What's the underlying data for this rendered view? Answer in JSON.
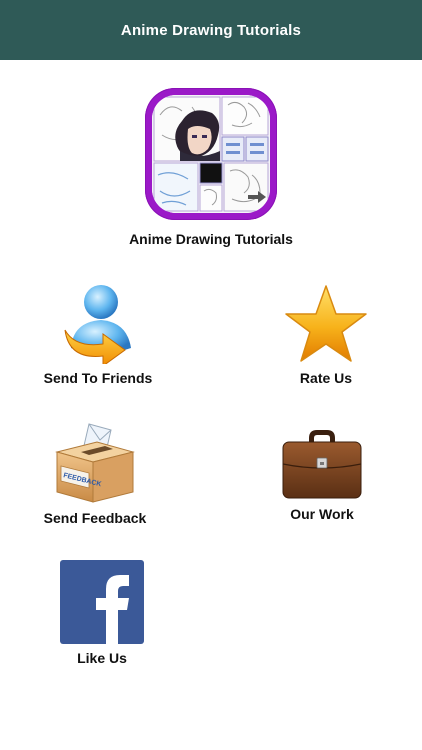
{
  "header": {
    "title": "Anime Drawing Tutorials"
  },
  "app": {
    "name": "Anime Drawing Tutorials"
  },
  "menu": {
    "send_to_friends": "Send To Friends",
    "rate_us": "Rate Us",
    "send_feedback": "Send Feedback",
    "our_work": "Our Work",
    "like_us": "Like Us",
    "feedback_box_text": "FEEDBACK"
  },
  "icons": {
    "app": "anime-drawing-app-icon",
    "send_to_friends": "user-share-icon",
    "rate_us": "star-icon",
    "send_feedback": "feedback-box-icon",
    "our_work": "briefcase-icon",
    "like_us": "facebook-icon"
  },
  "colors": {
    "header_bg": "#2f5a57",
    "app_icon_border": "#9b19c8",
    "facebook_blue": "#3b5998",
    "star_gold": "#f7b21a"
  }
}
